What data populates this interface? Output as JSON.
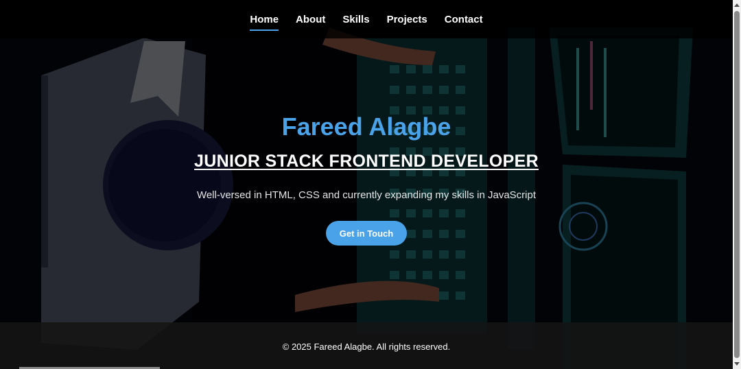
{
  "nav": {
    "items": [
      {
        "label": "Home",
        "active": true
      },
      {
        "label": "About",
        "active": false
      },
      {
        "label": "Skills",
        "active": false
      },
      {
        "label": "Projects",
        "active": false
      },
      {
        "label": "Contact",
        "active": false
      }
    ],
    "accent_color": "#4aa3e8"
  },
  "hero": {
    "name": "Fareed Alagbe",
    "role": "JUNIOR STACK FRONTEND DEVELOPER",
    "tagline": "Well-versed in HTML, CSS and currently expanding my skills in JavaScript",
    "cta_label": "Get in Touch",
    "background_icon": "developer-at-keyboard-illustration"
  },
  "footer": {
    "text": "© 2025 Fareed Alagbe. All rights reserved."
  },
  "colors": {
    "accent": "#4aa3e8",
    "background": "#000000",
    "text": "#ffffff"
  }
}
